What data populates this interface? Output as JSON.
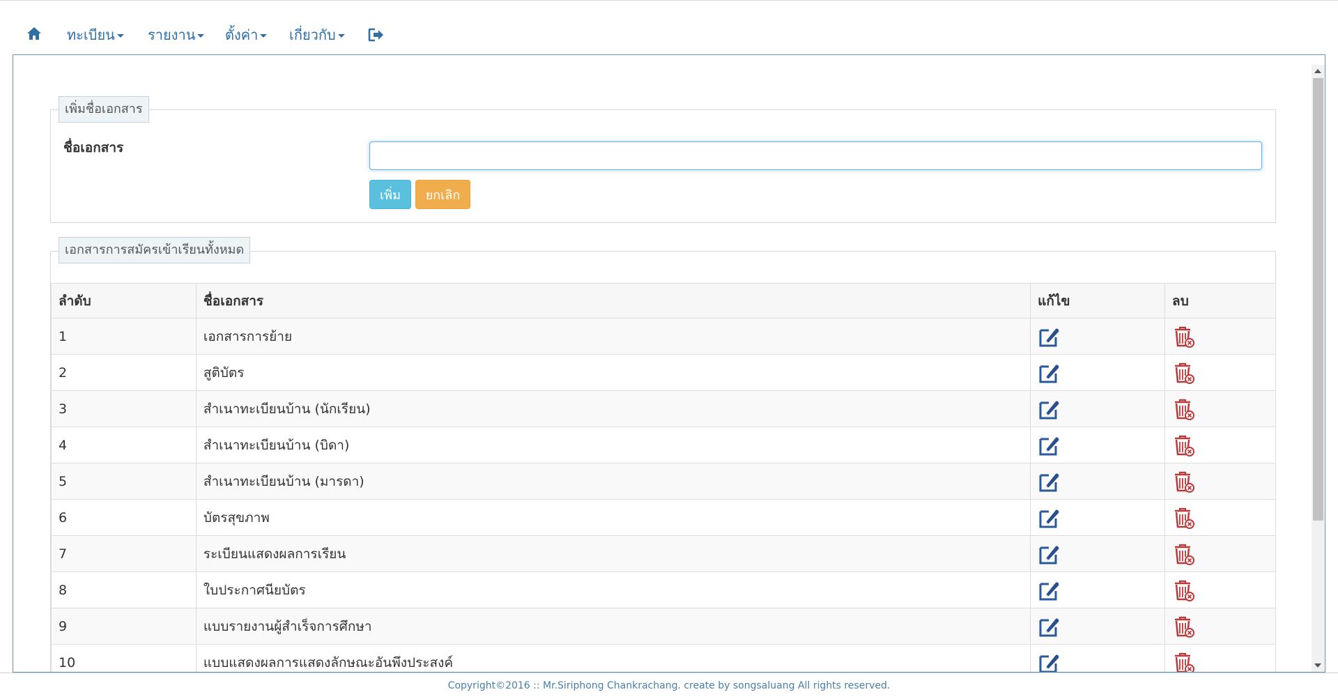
{
  "navbar": {
    "home_icon": "home-icon",
    "menus": [
      {
        "label": "ทะเบียน"
      },
      {
        "label": "รายงาน"
      },
      {
        "label": "ตั้งค่า"
      },
      {
        "label": "เกี่ยวกับ"
      }
    ],
    "logout_icon": "sign-out-icon",
    "link_color": "#2f6ea7"
  },
  "add_form": {
    "legend": "เพิ่มชื่อเอกสาร",
    "field_label": "ชื่อเอกสาร",
    "field_value": "",
    "add_button": "เพิ่ม",
    "cancel_button": "ยกเลิก",
    "add_color": "#5bc0de",
    "cancel_color": "#f0ad4e"
  },
  "documents": {
    "legend": "เอกสารการสมัครเข้าเรียนทั้งหมด",
    "headers": {
      "no": "ลำดับ",
      "name": "ชื่อเอกสาร",
      "edit": "แก้ไข",
      "delete": "ลบ"
    },
    "edit_icon": "edit-icon",
    "delete_icon": "trash-icon",
    "rows": [
      {
        "no": "1",
        "name": "เอกสารการย้าย"
      },
      {
        "no": "2",
        "name": "สูติบัตร"
      },
      {
        "no": "3",
        "name": "สำเนาทะเบียนบ้าน (นักเรียน)"
      },
      {
        "no": "4",
        "name": "สำเนาทะเบียนบ้าน (บิดา)"
      },
      {
        "no": "5",
        "name": "สำเนาทะเบียนบ้าน (มารดา)"
      },
      {
        "no": "6",
        "name": "บัตรสุขภาพ"
      },
      {
        "no": "7",
        "name": "ระเบียนแสดงผลการเรียน"
      },
      {
        "no": "8",
        "name": "ใบประกาศนียบัตร"
      },
      {
        "no": "9",
        "name": "แบบรายงานผู้สำเร็จการศึกษา"
      },
      {
        "no": "10",
        "name": "แบบแสดงผลการแสดงลักษณะอันพึงประสงค์"
      }
    ]
  },
  "footer": {
    "text": "Copyright©2016 :: Mr.Siriphong Chankrachang. create by songsaluang All rights reserved."
  }
}
